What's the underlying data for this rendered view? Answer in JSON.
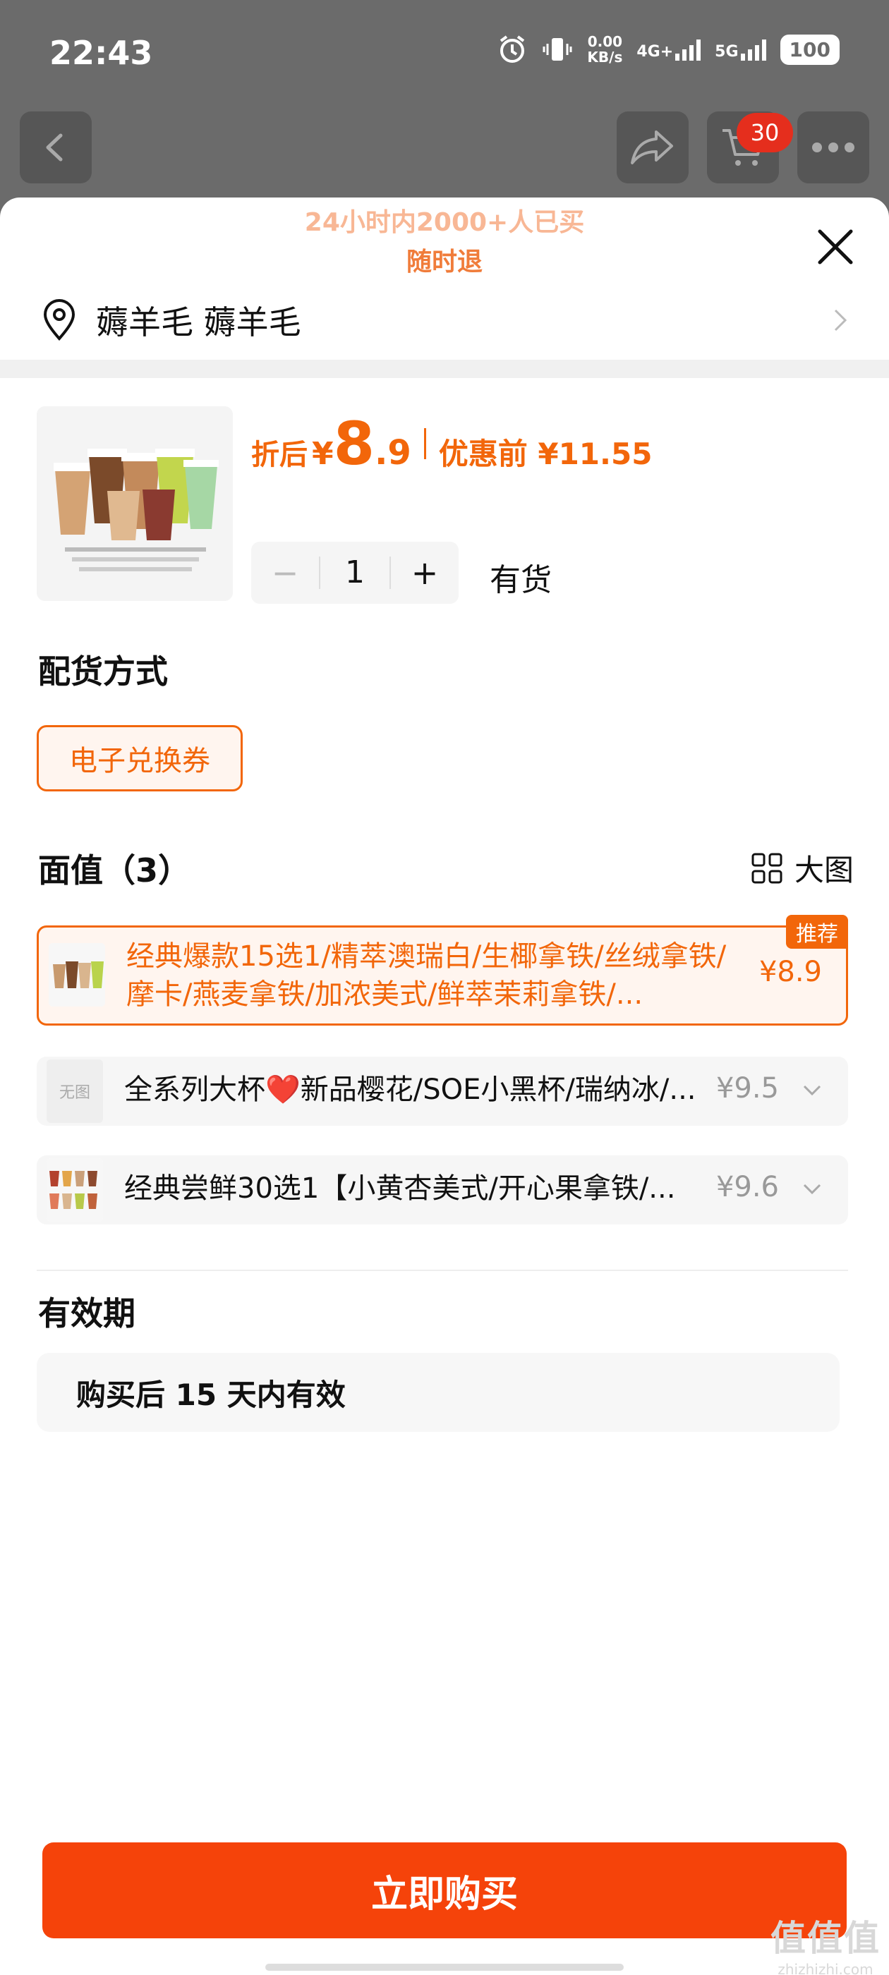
{
  "status_bar": {
    "time": "22:43",
    "net_speed_value": "0.00",
    "net_speed_unit": "KB/s",
    "sim1": "4G+",
    "sim2": "5G",
    "battery": "100"
  },
  "nav": {
    "cart_count": "30"
  },
  "sheet": {
    "sold_banner": "24小时内2000+人已买",
    "refund_text": "随时退",
    "address": "薅羊毛 薅羊毛"
  },
  "product": {
    "price_label": "折后",
    "currency": "¥",
    "price_int": "8",
    "price_dec": ".9",
    "pre_price": "优惠前 ¥11.55",
    "quantity": "1",
    "minus": "−",
    "plus": "+",
    "stock": "有货"
  },
  "delivery": {
    "title": "配货方式",
    "option": "电子兑换券"
  },
  "face_value": {
    "title": "面值（3）",
    "big_view": "大图",
    "options": [
      {
        "label": "经典爆款15选1/精萃澳瑞白/生椰拿铁/丝绒拿铁/摩卡/燕麦拿铁/加浓美式/鲜萃茉莉拿铁/...",
        "price": "¥8.9",
        "badge": "推荐"
      },
      {
        "label": "全系列大杯❤️新品樱花/SOE小黑杯/瑞纳冰/...",
        "price": "¥9.5",
        "thumb_text": "无图"
      },
      {
        "label": "经典尝鲜30选1【小黄杏美式/开心果拿铁/...",
        "price": "¥9.6"
      }
    ]
  },
  "validity": {
    "title": "有效期",
    "text": "购买后 15 天内有效"
  },
  "buy_button": "立即购买",
  "watermark": {
    "line1": "值值值",
    "line2": "zhizhizhi.com"
  },
  "colors": {
    "accent": "#f2660a",
    "buy": "#f5430a",
    "overlay": "#6b6b6b"
  }
}
